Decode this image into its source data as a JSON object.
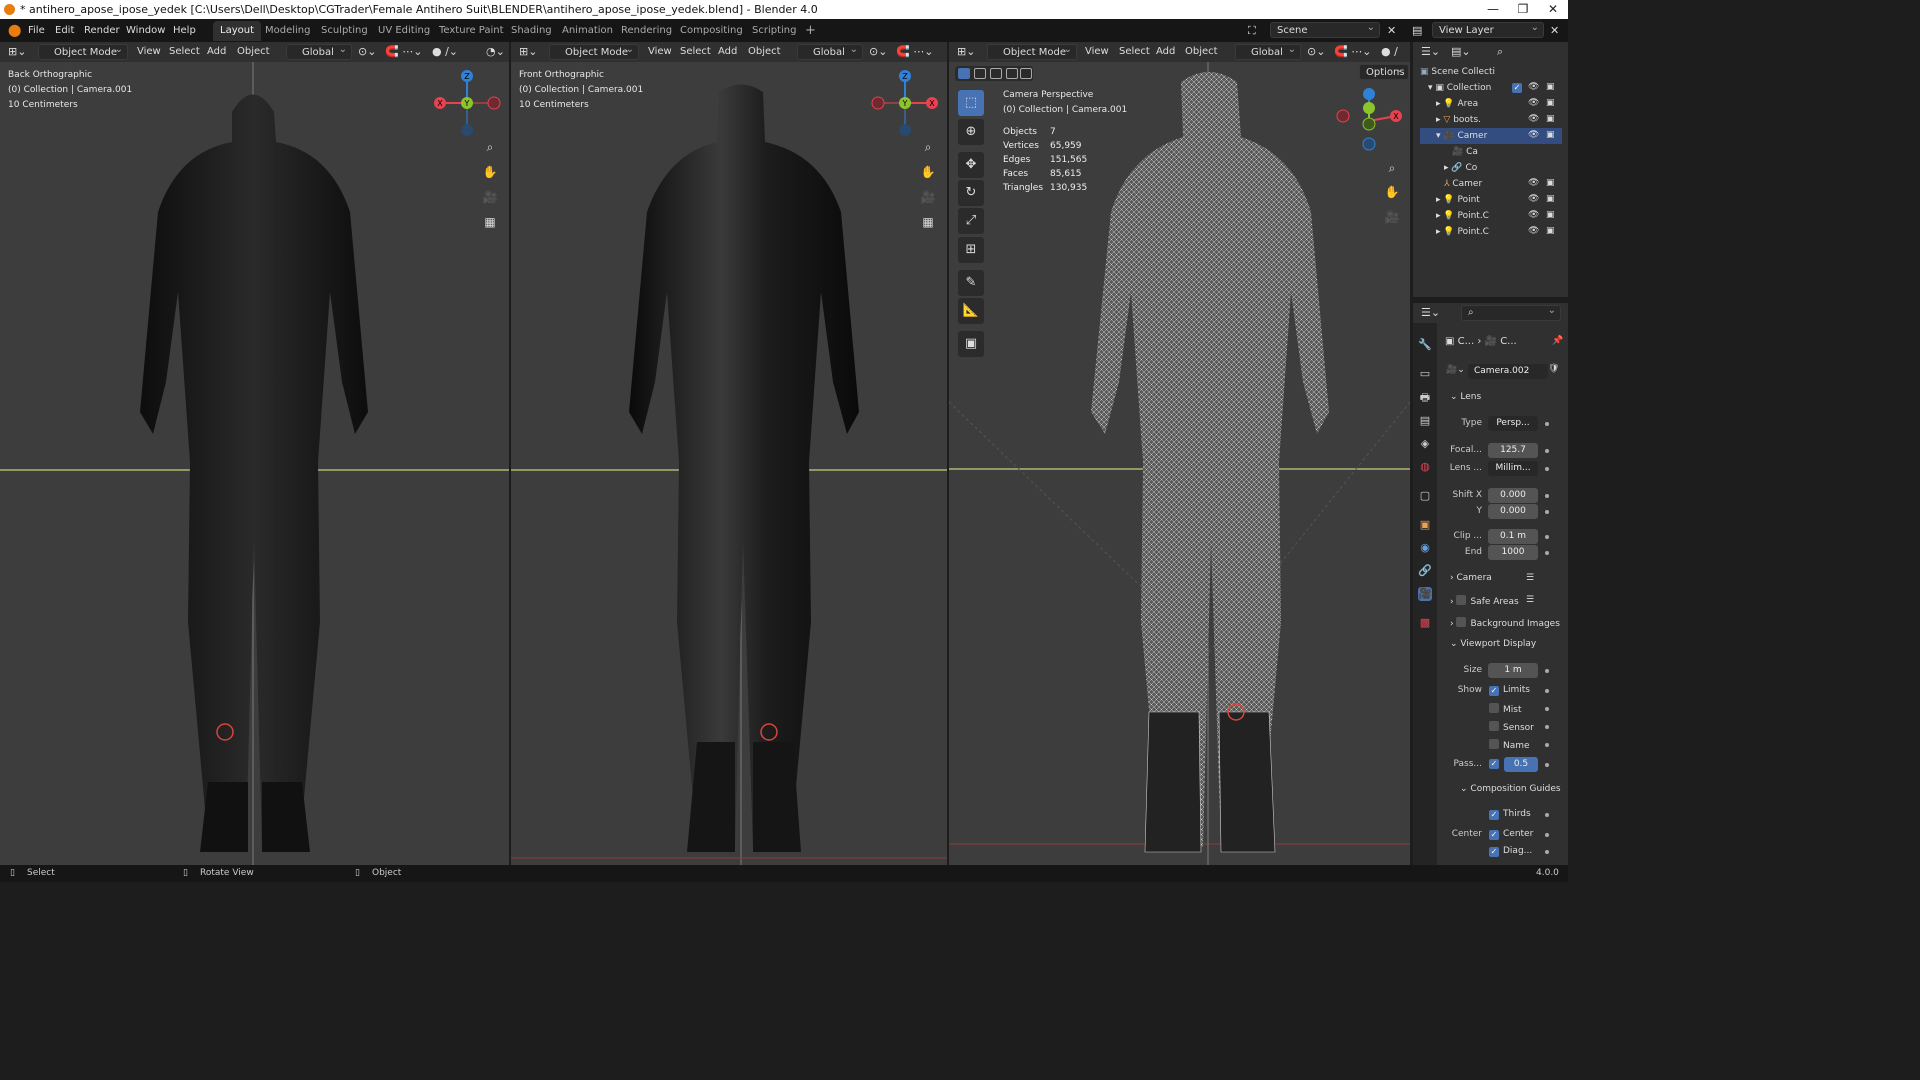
{
  "window": {
    "title": "* antihero_apose_ipose_yedek [C:\\Users\\Dell\\Desktop\\CGTrader\\Female Antihero Suit\\BLENDER\\antihero_apose_ipose_yedek.blend] - Blender 4.0",
    "minimize": "—",
    "maximize": "❐",
    "close": "✕"
  },
  "menu": [
    "File",
    "Edit",
    "Render",
    "Window",
    "Help"
  ],
  "workspaces": [
    "Layout",
    "Modeling",
    "Sculpting",
    "UV Editing",
    "Texture Paint",
    "Shading",
    "Animation",
    "Rendering",
    "Compositing",
    "Scripting"
  ],
  "active_workspace": "Layout",
  "scene": "Scene",
  "view_layer": "View Layer",
  "viewport_header": {
    "mode": "Object Mode",
    "view": "View",
    "select": "Select",
    "add": "Add",
    "object": "Object",
    "transform": "Global"
  },
  "viewport1": {
    "view_name": "Back Orthographic",
    "collection": "(0) Collection | Camera.001",
    "scale": "10 Centimeters"
  },
  "viewport2": {
    "view_name": "Front Orthographic",
    "collection": "(0) Collection | Camera.001",
    "scale": "10 Centimeters"
  },
  "viewport3": {
    "view_name": "Camera Perspective",
    "collection": "(0) Collection | Camera.001",
    "options": "Options",
    "stats": [
      {
        "label": "Objects",
        "value": "7"
      },
      {
        "label": "Vertices",
        "value": "65,959"
      },
      {
        "label": "Edges",
        "value": "151,565"
      },
      {
        "label": "Faces",
        "value": "85,615"
      },
      {
        "label": "Triangles",
        "value": "130,935"
      }
    ]
  },
  "gizmo_axes": {
    "x": "X",
    "y": "Y",
    "z": "Z"
  },
  "outliner": {
    "root": "Scene Collecti",
    "items": [
      {
        "name": "Collection",
        "level": 1
      },
      {
        "name": "Area",
        "level": 2
      },
      {
        "name": "boots.",
        "level": 2
      },
      {
        "name": "Camer",
        "level": 2
      },
      {
        "name": "Ca",
        "level": 3
      },
      {
        "name": "Co",
        "level": 3
      },
      {
        "name": "Camer",
        "level": 2
      },
      {
        "name": "Point",
        "level": 2
      },
      {
        "name": "Point.C",
        "level": 2
      },
      {
        "name": "Point.C",
        "level": 2
      }
    ]
  },
  "properties": {
    "breadcrumb_a": "C...",
    "breadcrumb_b": "C...",
    "camera_name": "Camera.002",
    "lens_section": "Lens",
    "type_label": "Type",
    "type_value": "Persp...",
    "focal_label": "Focal...",
    "focal_value": "125.7",
    "lens_unit_label": "Lens ...",
    "lens_unit_value": "Millim...",
    "shiftx_label": "Shift X",
    "shiftx_value": "0.000",
    "shifty_label": "Y",
    "shifty_value": "0.000",
    "clip_label": "Clip ...",
    "clip_value": "0.1 m",
    "end_label": "End",
    "end_value": "1000",
    "camera_section": "Camera",
    "safe_areas": "Safe Areas",
    "background_images": "Background Images",
    "viewport_display": "Viewport Display",
    "size_label": "Size",
    "size_value": "1 m",
    "show_label": "Show",
    "limits": "Limits",
    "mist": "Mist",
    "sensor": "Sensor",
    "name": "Name",
    "pass_label": "Pass...",
    "pass_value": "0.5",
    "composition_guides": "Composition Guides",
    "thirds": "Thirds",
    "center_label": "Center",
    "center": "Center",
    "diag": "Diag..."
  },
  "status": {
    "select": "Select",
    "rotate": "Rotate View",
    "object": "Object",
    "version": "4.0.0"
  },
  "colors": {
    "accent": "#4772b3",
    "x_axis": "#e8414f",
    "y_axis": "#8bc52b",
    "z_axis": "#2f82d8",
    "horizon": "#c7cf7d"
  }
}
